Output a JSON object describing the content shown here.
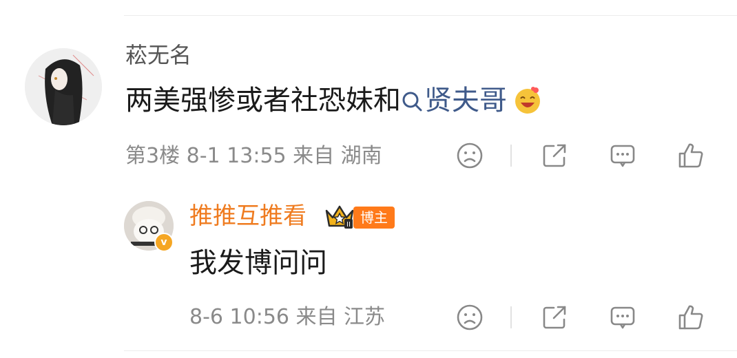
{
  "comment1": {
    "username": "菘无名",
    "text": "两美强惨或者社恐妹和",
    "topic_link": "贤夫哥",
    "emoji": "emoji-laughing-icon",
    "meta": "第3楼 8-1 13:55 来自 湖南"
  },
  "comment2": {
    "username": "推推互推看",
    "badge": "博主",
    "text": "我发博问问",
    "meta": "8-6 10:56 来自 江苏"
  },
  "colors": {
    "username_blogger": "#ef7b1f",
    "topic_link": "#3f5a8a",
    "meta": "#8a8a8a",
    "badge_bg": "#ff7a1a"
  }
}
